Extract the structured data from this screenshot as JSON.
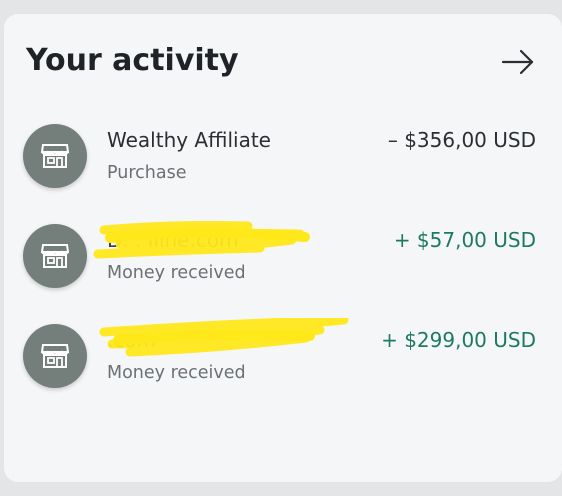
{
  "header": {
    "title": "Your activity",
    "arrow_icon": "arrow-right-icon"
  },
  "colors": {
    "card_background": "#f5f6f8",
    "avatar": "#747f7c",
    "positive_amount": "#1d7b5c",
    "negative_amount": "#2b2f33",
    "redaction_marker": "#ffe81a"
  },
  "activity": [
    {
      "icon": "storefront-icon",
      "name": "Wealthy Affiliate",
      "subtitle": "Purchase",
      "amount": "– $356,00 USD",
      "direction": "negative",
      "redacted": false
    },
    {
      "icon": "storefront-icon",
      "name": "D.        .      iline.com",
      "subtitle": "Money received",
      "amount": "+ $57,00 USD",
      "direction": "positive",
      "redacted": true
    },
    {
      "icon": "storefront-icon",
      "name": "                       .com",
      "subtitle": "Money received",
      "amount": "+ $299,00 USD",
      "direction": "positive",
      "redacted": true
    }
  ]
}
